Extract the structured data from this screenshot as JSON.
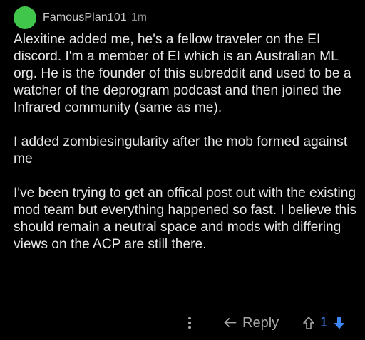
{
  "comment": {
    "author": "FamousPlan101",
    "age": "1m",
    "avatar_color": "#3fc64b",
    "paragraphs": [
      "Alexitine added me, he's a fellow traveler on the EI discord. I'm a member of EI which is an Australian ML org. He is the founder of this subreddit and used to be a watcher of the deprogram podcast and then joined the Infrared community (same as me).",
      "I added zombiesingularity after the mob formed against me",
      "I've been trying to get an offical post out with the existing mod team but everything happened so fast. I believe this should remain a neutral space and mods with differing views on the ACP are still there."
    ]
  },
  "actions": {
    "more_icon": "vertical-ellipsis-icon",
    "reply_icon": "reply-arrow-icon",
    "reply_label": "Reply",
    "upvote_icon": "upvote-arrow-icon",
    "score": "1",
    "downvote_icon": "downvote-arrow-icon",
    "score_color": "#3b86f5",
    "muted_color": "#a8a8a8"
  }
}
